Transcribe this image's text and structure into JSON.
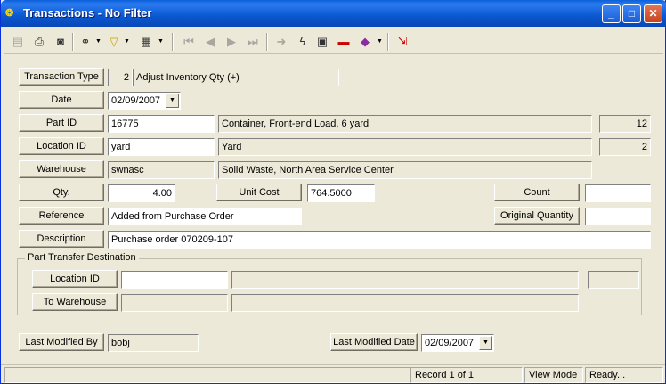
{
  "window": {
    "title": "Transactions - No Filter",
    "minimize": "_",
    "maximize": "□",
    "close": "✕"
  },
  "toolbar_icons": [
    "list-icon",
    "print-icon",
    "print-preview-icon",
    "binoculars-icon",
    "filter-icon",
    "report-icon",
    "first-record-icon",
    "prev-record-icon",
    "next-record-icon",
    "last-record-icon",
    "go-icon",
    "lightning-icon",
    "calculator-icon",
    "bookmark-icon",
    "book-icon",
    "exit-icon"
  ],
  "form": {
    "transaction_type": {
      "label": "Transaction Type",
      "code": "2",
      "desc": "Adjust Inventory Qty (+)"
    },
    "date": {
      "label": "Date",
      "value": "02/09/2007"
    },
    "part_id": {
      "label": "Part ID",
      "value": "16775",
      "desc": "Container, Front-end Load, 6 yard",
      "count": "12"
    },
    "location_id": {
      "label": "Location ID",
      "value": "yard",
      "desc": "Yard",
      "count": "2"
    },
    "warehouse": {
      "label": "Warehouse",
      "value": "swnasc",
      "desc": "Solid Waste,  North Area Service Center"
    },
    "qty": {
      "label": "Qty.",
      "value": "4.00"
    },
    "unit_cost": {
      "label": "Unit Cost",
      "value": "764.5000"
    },
    "count": {
      "label": "Count",
      "value": ""
    },
    "reference": {
      "label": "Reference",
      "value": "Added from Purchase Order"
    },
    "original_quantity": {
      "label": "Original Quantity",
      "value": ""
    },
    "description": {
      "label": "Description",
      "value": "Purchase order 070209-107"
    },
    "transfer": {
      "title": "Part Transfer Destination",
      "location_label": "Location ID",
      "warehouse_label": "To Warehouse"
    },
    "last_modified_by": {
      "label": "Last Modified By",
      "value": "bobj"
    },
    "last_modified_date": {
      "label": "Last Modified Date",
      "value": "02/09/2007"
    }
  },
  "status": {
    "record": "Record 1 of 1",
    "mode": "View Mode",
    "state": "Ready..."
  }
}
